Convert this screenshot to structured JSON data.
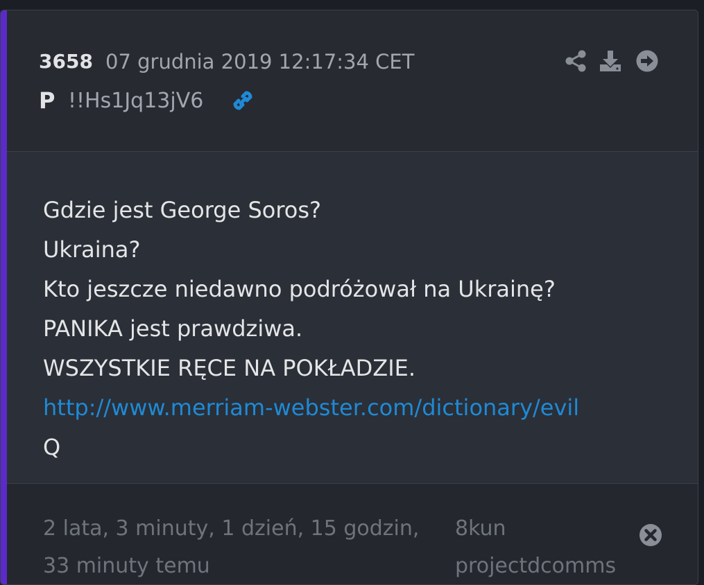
{
  "post": {
    "number": "3658",
    "date": "07 grudnia 2019 12:17:34 CET",
    "author": "P",
    "tripcode": "!!Hs1Jq13jV6",
    "icons": {
      "link": "link-icon",
      "share": "share-icon",
      "download": "download-icon",
      "forward": "arrow-right-circle-icon",
      "close": "close-circle-icon"
    },
    "lines": [
      "Gdzie jest George Soros?",
      "Ukraina?",
      "Kto jeszcze niedawno podróżował na Ukrainę?",
      "PANIKA jest prawdziwa.",
      "WSZYSTKIE RĘCE NA POKŁADZIE.",
      "http://www.merriam-webster.com/dictionary/evil",
      "Q"
    ],
    "time_ago": "2 lata, 3 minuty, 1 dzień, 15 godzin, 33 minuty temu",
    "source": "8kun projectdcomms"
  },
  "colors": {
    "accent": "#5a2bc9",
    "link": "#1e8ad6",
    "background": "#24272e"
  }
}
